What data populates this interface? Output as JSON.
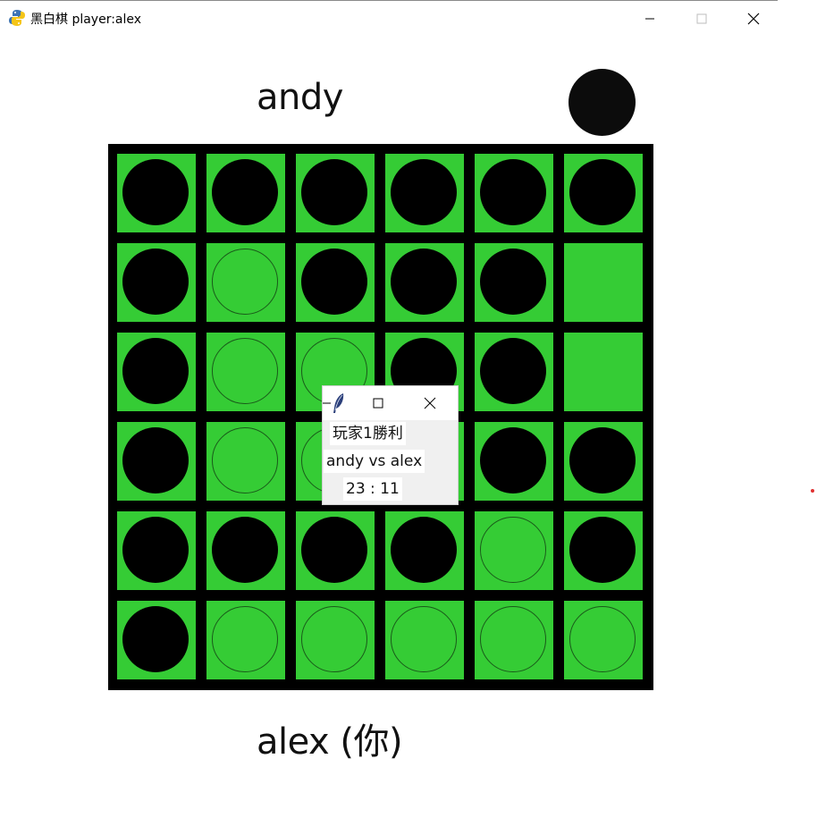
{
  "window": {
    "title": "黑白棋 player:alex",
    "app_icon": "python-snake-icon"
  },
  "players": {
    "top": "andy",
    "bottom": "alex (你)"
  },
  "turn_indicator": {
    "color": "#0c0c0c",
    "icon": "black-disc-icon"
  },
  "board": {
    "size": 6,
    "cell_color": "#35cc35",
    "grid_color": "#000000",
    "rows": [
      [
        "black",
        "black",
        "black",
        "black",
        "black",
        "black"
      ],
      [
        "black",
        "hint",
        "black",
        "black",
        "black",
        "empty"
      ],
      [
        "black",
        "hint",
        "hint",
        "black",
        "black",
        "empty"
      ],
      [
        "black",
        "hint",
        "hint",
        "black",
        "black",
        "black"
      ],
      [
        "black",
        "black",
        "black",
        "black",
        "hint",
        "black"
      ],
      [
        "black",
        "hint",
        "hint",
        "hint",
        "hint",
        "hint"
      ]
    ]
  },
  "dialog": {
    "icon": "tk-feather-icon",
    "winner": "玩家1勝利",
    "matchup": "andy vs alex",
    "score": "23 : 11"
  }
}
